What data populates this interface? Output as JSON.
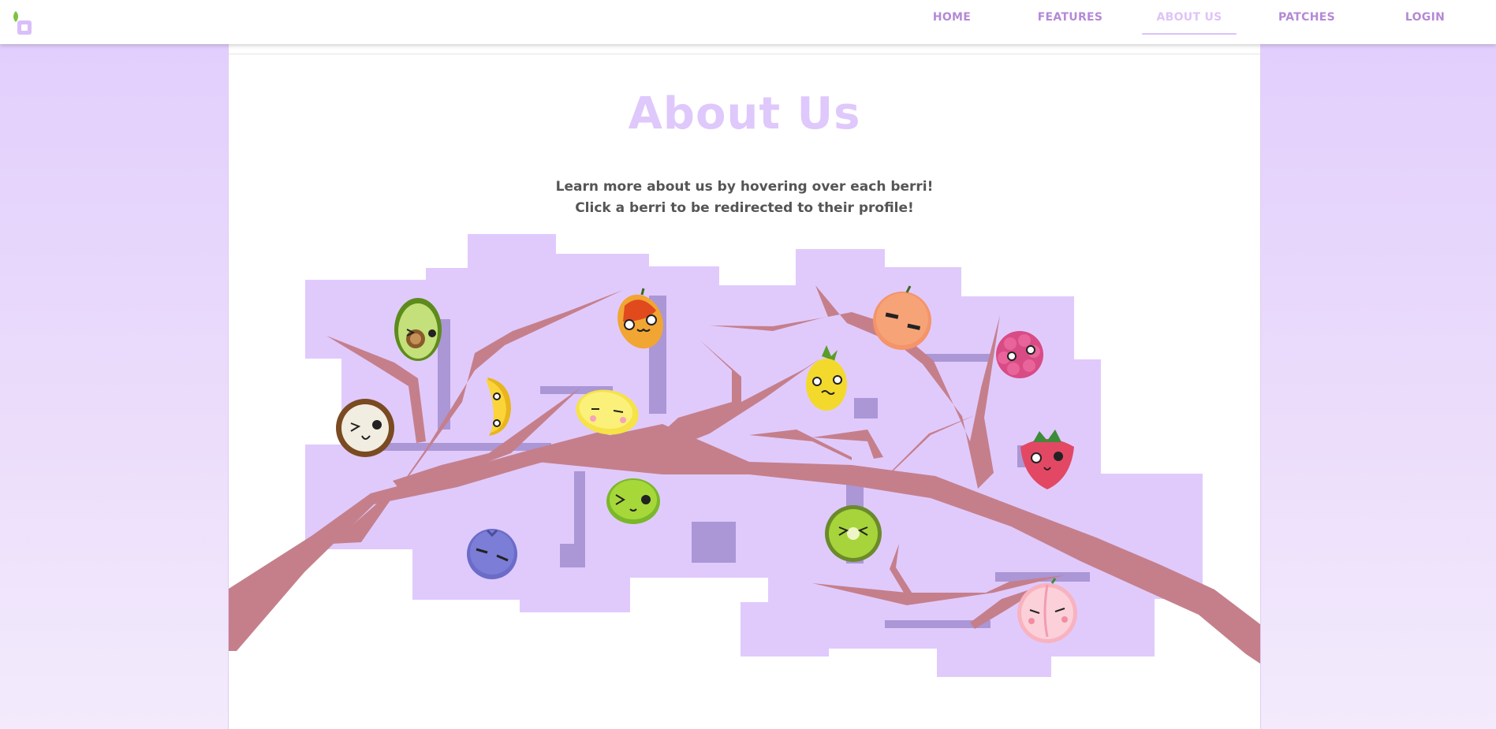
{
  "nav": {
    "items": [
      {
        "label": "HOME"
      },
      {
        "label": "FEATURES"
      },
      {
        "label": "ABOUT US"
      },
      {
        "label": "PATCHES"
      },
      {
        "label": "LOGIN"
      }
    ],
    "active_index": 2
  },
  "page": {
    "title": "About Us",
    "intro_line_1": "Learn more about us by hovering over each berri!",
    "intro_line_2": "Click a berri to be redirected to their profile!"
  },
  "berris": [
    {
      "fruit": "avocado",
      "icon": "avocado-icon"
    },
    {
      "fruit": "mango",
      "icon": "mango-icon"
    },
    {
      "fruit": "orange",
      "icon": "orange-icon"
    },
    {
      "fruit": "raspberry",
      "icon": "raspberry-icon"
    },
    {
      "fruit": "coconut",
      "icon": "coconut-icon"
    },
    {
      "fruit": "banana",
      "icon": "banana-icon"
    },
    {
      "fruit": "lemon",
      "icon": "lemon-icon"
    },
    {
      "fruit": "pineapple",
      "icon": "pineapple-icon"
    },
    {
      "fruit": "strawberry",
      "icon": "strawberry-icon"
    },
    {
      "fruit": "lime",
      "icon": "lime-icon"
    },
    {
      "fruit": "blueberry",
      "icon": "blueberry-icon"
    },
    {
      "fruit": "kiwi",
      "icon": "kiwi-icon"
    },
    {
      "fruit": "peach",
      "icon": "peach-icon"
    }
  ],
  "colors": {
    "background_top": "#e1cdfd",
    "background_bottom": "#f3ebfc",
    "nav_link": "#b489d6",
    "nav_active": "#dfc3f7",
    "title": "#dfc8fb",
    "intro_text": "#555555",
    "foliage": "#e0cafc",
    "foliage_dark": "#ab96d6",
    "branch": "#c57f8b"
  }
}
